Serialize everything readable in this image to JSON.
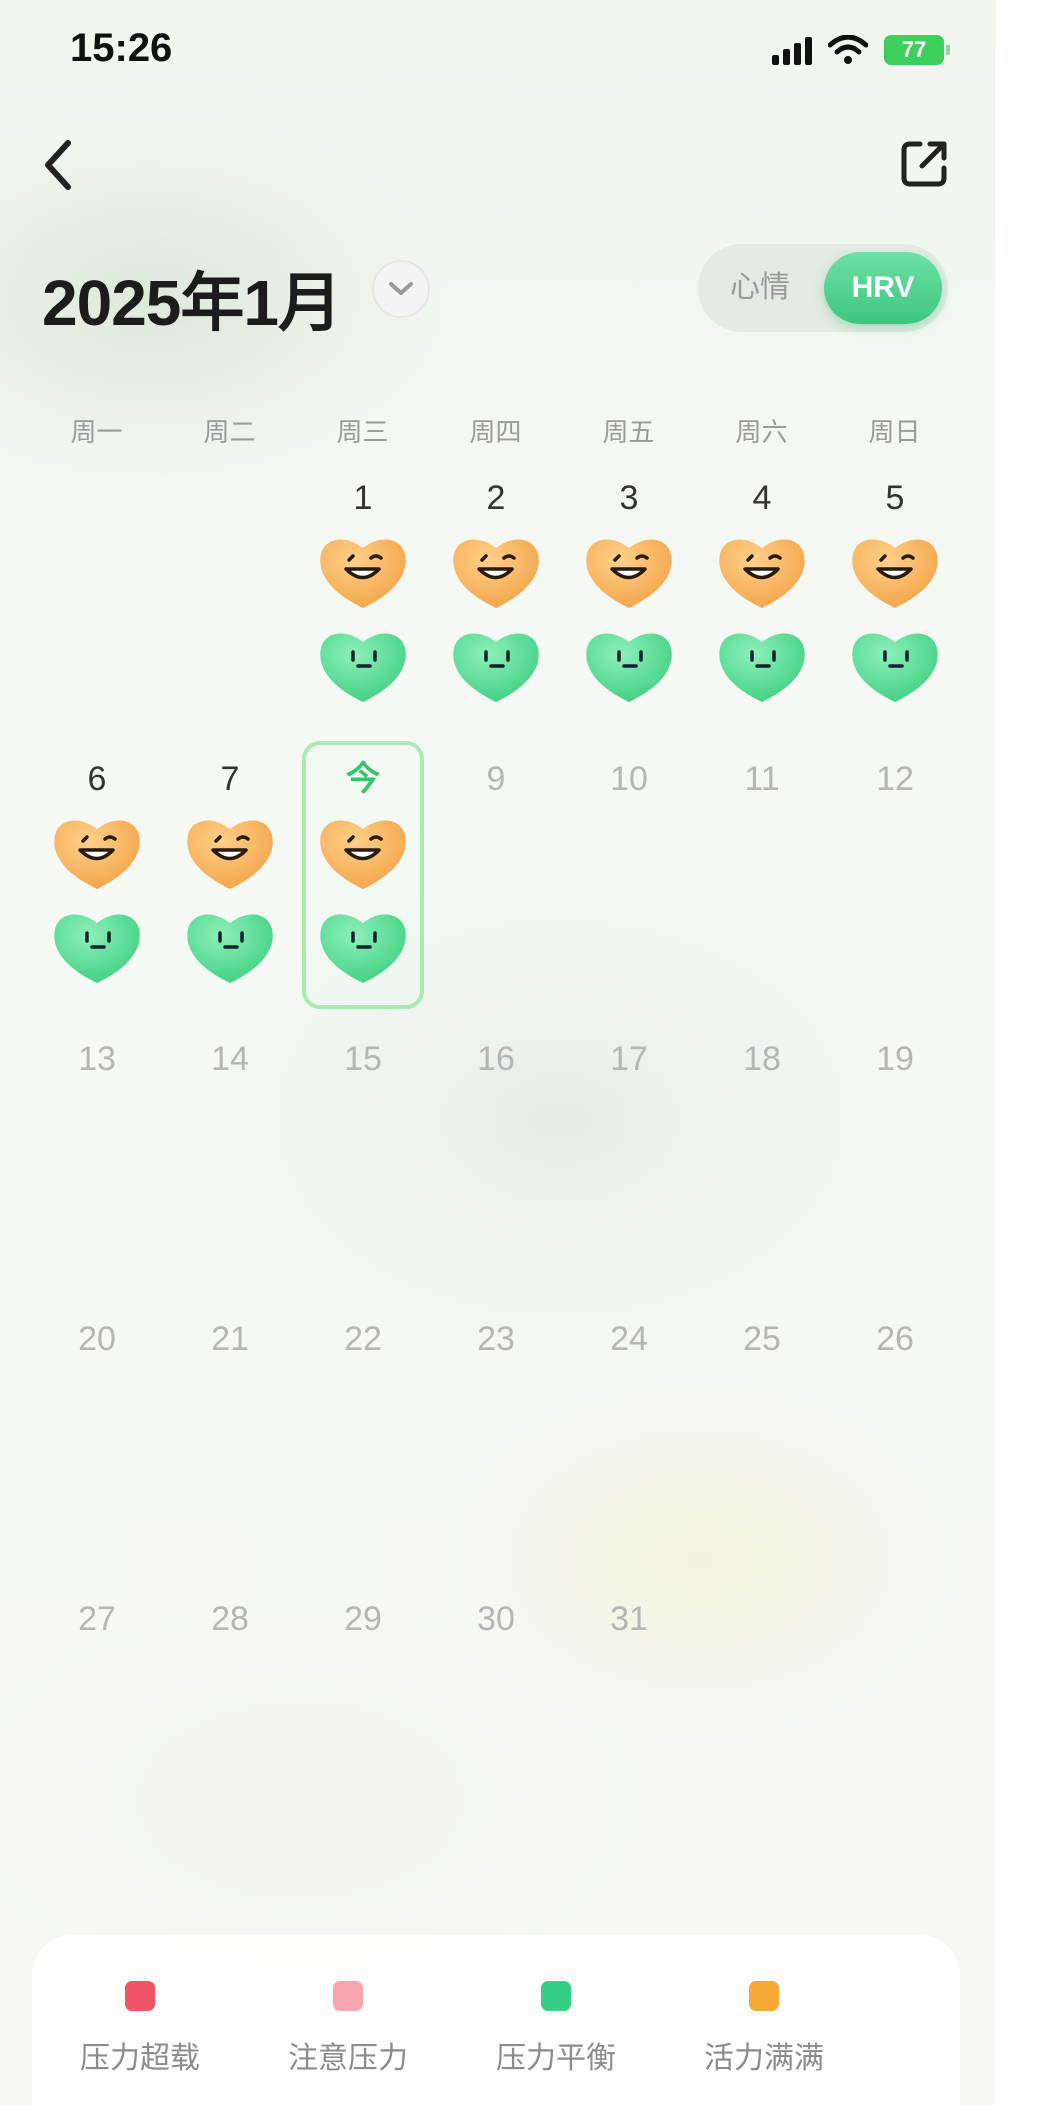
{
  "status_bar": {
    "time": "15:26",
    "battery": "77"
  },
  "header": {
    "month_title": "2025年1月"
  },
  "toggle": {
    "mood_label": "心情",
    "hrv_label": "HRV",
    "selected": "HRV"
  },
  "weekdays": [
    "周一",
    "周二",
    "周三",
    "周四",
    "周五",
    "周六",
    "周日"
  ],
  "calendar": {
    "today_label": "今",
    "days": [
      {
        "label": "1",
        "has_data": true
      },
      {
        "label": "2",
        "has_data": true
      },
      {
        "label": "3",
        "has_data": true
      },
      {
        "label": "4",
        "has_data": true
      },
      {
        "label": "5",
        "has_data": true
      },
      {
        "label": "6",
        "has_data": true
      },
      {
        "label": "7",
        "has_data": true
      },
      {
        "label": "今",
        "has_data": true,
        "today": true
      },
      {
        "label": "9"
      },
      {
        "label": "10"
      },
      {
        "label": "11"
      },
      {
        "label": "12"
      },
      {
        "label": "13"
      },
      {
        "label": "14"
      },
      {
        "label": "15"
      },
      {
        "label": "16"
      },
      {
        "label": "17"
      },
      {
        "label": "18"
      },
      {
        "label": "19"
      },
      {
        "label": "20"
      },
      {
        "label": "21"
      },
      {
        "label": "22"
      },
      {
        "label": "23"
      },
      {
        "label": "24"
      },
      {
        "label": "25"
      },
      {
        "label": "26"
      },
      {
        "label": "27"
      },
      {
        "label": "28"
      },
      {
        "label": "29"
      },
      {
        "label": "30"
      },
      {
        "label": "31"
      }
    ]
  },
  "legend": [
    {
      "label": "压力超载",
      "color": "#f25467"
    },
    {
      "label": "注意压力",
      "color": "#f7a6b0"
    },
    {
      "label": "压力平衡",
      "color": "#35cf86"
    },
    {
      "label": "活力满满",
      "color": "#f7a935"
    }
  ],
  "icons": {
    "back": "chevron-left-icon",
    "share": "share-icon",
    "dropdown": "chevron-down-icon",
    "mood_orange": "heart-orange-laughing-icon",
    "mood_green": "heart-green-calm-icon"
  }
}
